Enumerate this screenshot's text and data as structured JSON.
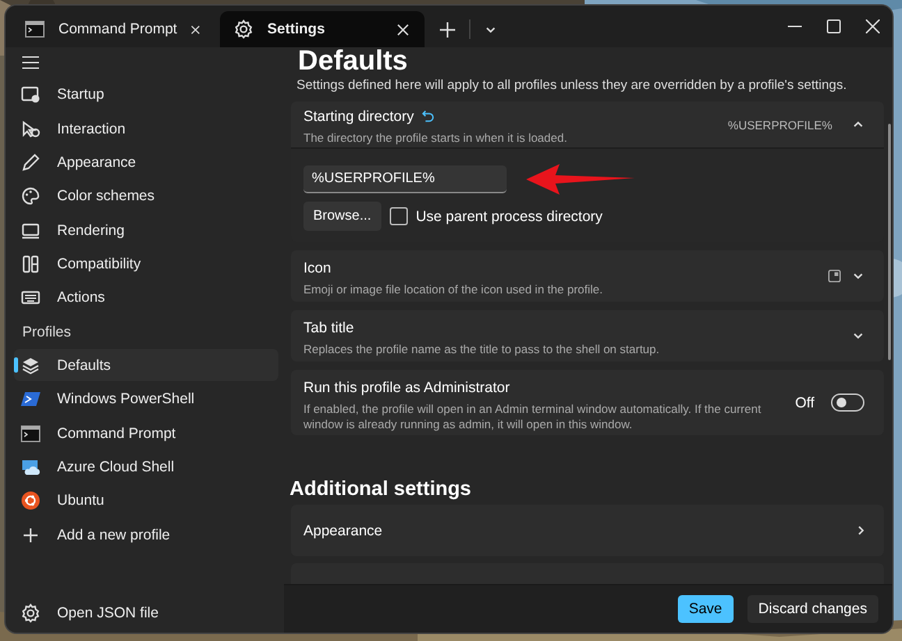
{
  "tabs": [
    {
      "label": "Command Prompt",
      "kind": "terminal",
      "selected": false
    },
    {
      "label": "Settings",
      "kind": "gear",
      "selected": true
    }
  ],
  "sidebar": {
    "items": [
      {
        "label": "Startup",
        "kind": "startup",
        "selected": false
      },
      {
        "label": "Interaction",
        "kind": "interaction",
        "selected": false
      },
      {
        "label": "Appearance",
        "kind": "pen",
        "selected": false
      },
      {
        "label": "Color schemes",
        "kind": "palette",
        "selected": false
      },
      {
        "label": "Rendering",
        "kind": "monitor",
        "selected": false
      },
      {
        "label": "Compatibility",
        "kind": "tools",
        "selected": false
      },
      {
        "label": "Actions",
        "kind": "keyboard",
        "selected": false
      }
    ],
    "profiles_header": "Profiles",
    "profiles": [
      {
        "label": "Defaults",
        "kind": "layers",
        "selected": true
      },
      {
        "label": "Windows PowerShell",
        "kind": "powershell",
        "selected": false
      },
      {
        "label": "Command Prompt",
        "kind": "terminal",
        "selected": false
      },
      {
        "label": "Azure Cloud Shell",
        "kind": "cloud",
        "selected": false
      },
      {
        "label": "Ubuntu",
        "kind": "ubuntu",
        "selected": false
      },
      {
        "label": "Add a new profile",
        "kind": "plus",
        "selected": false
      }
    ],
    "footer_item": "Open JSON file"
  },
  "page": {
    "title": "Defaults",
    "subtitle": "Settings defined here will apply to all profiles unless they are overridden by a profile's settings.",
    "settings": [
      {
        "kind": "directory",
        "title": "Starting directory",
        "description": "The directory the profile starts in when it is loaded.",
        "value": "%USERPROFILE%",
        "expanded": true,
        "field_value": "%USERPROFILE%",
        "browse": "Browse...",
        "checkbox": {
          "label": "Use parent process directory",
          "checked": false
        }
      },
      {
        "kind": "icon",
        "title": "Icon",
        "description": "Emoji or image file location of the icon used in the profile.",
        "expanded": false
      },
      {
        "kind": "expander",
        "title": "Tab title",
        "description": "Replaces the profile name as the title to pass to the shell on startup.",
        "expanded": false
      },
      {
        "kind": "toggle",
        "title": "Run this profile as Administrator",
        "description": "If enabled, the profile will open in an Admin terminal window automatically. If the current window is already running as admin, it will open in this window.",
        "state_label": "Off",
        "on": false
      }
    ],
    "additional_heading": "Additional settings",
    "additional": [
      {
        "label": "Appearance"
      }
    ]
  },
  "footer": {
    "save": "Save",
    "discard": "Discard changes"
  }
}
